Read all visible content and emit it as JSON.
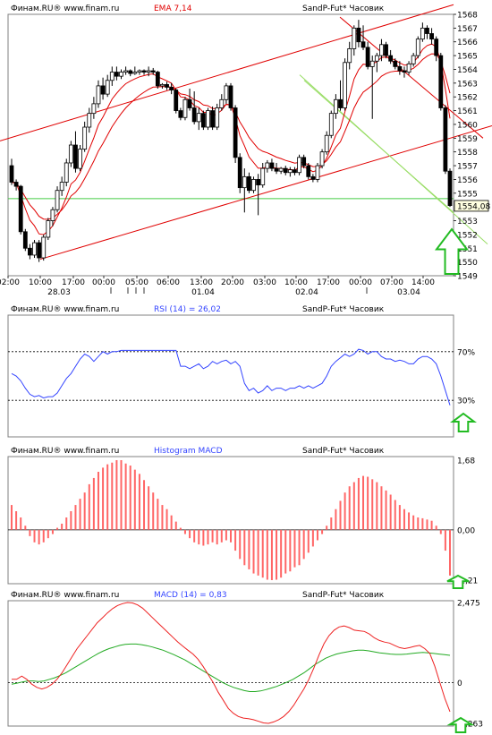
{
  "source": "Финам.RU®  www.finam.ru",
  "instrument": "SandP-Fut* Часовик",
  "colors": {
    "background": "#ffffff",
    "panel_border": "#808080",
    "ema": "#e00000",
    "channel": "#e00000",
    "fan": "#99dd66",
    "horizontal": "#44cc44",
    "rsi": "#3344ff",
    "histogram": "#ff6666",
    "macd": "#ee2222",
    "signal": "#22aa22",
    "arrow": "#22bb22",
    "price_box": "#ffffe0"
  },
  "chart_data": [
    {
      "type": "candlestick",
      "title": "EMA 7,14",
      "last_price": "1554,08",
      "ylim": [
        1549,
        1568
      ],
      "y_ticks": [
        "1568",
        "1567",
        "1566",
        "1565",
        "1564",
        "1563",
        "1562",
        "1561",
        "1560",
        "1559",
        "1558",
        "1557",
        "1556",
        "1555",
        "1554,08",
        "1553",
        "1552",
        "1551",
        "1550",
        "1549"
      ],
      "x_ticks": [
        "02:00",
        "10:00",
        "17:00",
        "00:00",
        "05:00",
        "06:00",
        "13:00",
        "20:00",
        "03:00",
        "10:00",
        "17:00",
        "00:00",
        "07:00",
        "14:00"
      ],
      "date_labels": [
        "28.03",
        "01.04",
        "02.04",
        "03.04"
      ],
      "series": [
        {
          "name": "EMA 7",
          "kind": "line"
        },
        {
          "name": "EMA 14",
          "kind": "line"
        }
      ],
      "candles": [
        [
          1557.0,
          1557.5,
          1555.6,
          1555.8
        ],
        [
          1555.8,
          1556.0,
          1555.2,
          1555.5
        ],
        [
          1555.5,
          1555.6,
          1552.0,
          1552.2
        ],
        [
          1552.2,
          1552.4,
          1550.8,
          1551.0
        ],
        [
          1551.0,
          1551.3,
          1550.2,
          1550.5
        ],
        [
          1550.5,
          1551.6,
          1550.3,
          1551.4
        ],
        [
          1551.4,
          1551.6,
          1550.0,
          1550.3
        ],
        [
          1550.3,
          1552.0,
          1550.1,
          1551.8
        ],
        [
          1551.8,
          1553.2,
          1551.6,
          1553.0
        ],
        [
          1553.0,
          1554.0,
          1552.6,
          1553.8
        ],
        [
          1553.8,
          1555.5,
          1553.6,
          1555.2
        ],
        [
          1555.2,
          1556.2,
          1554.8,
          1555.8
        ],
        [
          1555.8,
          1557.5,
          1555.5,
          1557.2
        ],
        [
          1557.2,
          1558.8,
          1556.9,
          1558.5
        ],
        [
          1558.5,
          1559.5,
          1556.5,
          1556.8
        ],
        [
          1556.8,
          1558.5,
          1556.6,
          1558.2
        ],
        [
          1558.2,
          1560.2,
          1558.0,
          1559.8
        ],
        [
          1559.8,
          1561.2,
          1559.4,
          1560.8
        ],
        [
          1560.8,
          1562.0,
          1560.4,
          1561.5
        ],
        [
          1561.5,
          1563.2,
          1561.2,
          1562.8
        ],
        [
          1562.8,
          1563.4,
          1561.8,
          1562.2
        ],
        [
          1562.2,
          1563.6,
          1562.0,
          1563.2
        ],
        [
          1563.2,
          1564.2,
          1562.8,
          1563.8
        ],
        [
          1563.8,
          1564.2,
          1563.2,
          1563.5
        ],
        [
          1563.5,
          1564.0,
          1563.3,
          1563.8
        ],
        [
          1563.8,
          1564.2,
          1563.6,
          1563.9
        ],
        [
          1563.9,
          1564.0,
          1563.5,
          1563.7
        ],
        [
          1563.7,
          1564.2,
          1563.6,
          1563.8
        ],
        [
          1563.8,
          1564.0,
          1563.6,
          1563.9
        ],
        [
          1563.9,
          1564.0,
          1563.6,
          1563.8
        ],
        [
          1563.8,
          1564.2,
          1563.5,
          1563.9
        ],
        [
          1563.9,
          1564.1,
          1563.6,
          1563.8
        ],
        [
          1563.8,
          1563.9,
          1562.6,
          1562.8
        ],
        [
          1562.8,
          1563.0,
          1562.6,
          1562.9
        ],
        [
          1562.9,
          1563.1,
          1562.5,
          1562.7
        ],
        [
          1562.7,
          1563.0,
          1562.2,
          1562.5
        ],
        [
          1562.5,
          1562.6,
          1560.8,
          1561.0
        ],
        [
          1561.0,
          1561.2,
          1560.3,
          1560.5
        ],
        [
          1560.5,
          1562.0,
          1560.3,
          1561.8
        ],
        [
          1561.8,
          1562.6,
          1561.0,
          1561.2
        ],
        [
          1561.2,
          1562.4,
          1560.0,
          1560.2
        ],
        [
          1560.2,
          1561.2,
          1559.6,
          1560.8
        ],
        [
          1560.8,
          1561.0,
          1559.6,
          1559.8
        ],
        [
          1559.8,
          1561.2,
          1559.6,
          1561.0
        ],
        [
          1561.0,
          1561.3,
          1559.6,
          1559.8
        ],
        [
          1559.8,
          1561.5,
          1559.6,
          1561.2
        ],
        [
          1561.2,
          1562.2,
          1561.0,
          1561.8
        ],
        [
          1561.8,
          1563.0,
          1561.5,
          1562.8
        ],
        [
          1562.8,
          1563.0,
          1561.0,
          1561.2
        ],
        [
          1561.2,
          1561.4,
          1557.2,
          1557.6
        ],
        [
          1557.6,
          1557.9,
          1555.0,
          1555.4
        ],
        [
          1555.4,
          1556.8,
          1553.6,
          1556.2
        ],
        [
          1556.2,
          1556.5,
          1555.0,
          1555.2
        ],
        [
          1555.2,
          1556.2,
          1555.0,
          1556.0
        ],
        [
          1556.0,
          1556.4,
          1553.4,
          1555.6
        ],
        [
          1555.6,
          1557.2,
          1555.4,
          1556.8
        ],
        [
          1556.8,
          1557.4,
          1556.5,
          1557.2
        ],
        [
          1557.2,
          1557.5,
          1556.6,
          1556.8
        ],
        [
          1556.8,
          1557.2,
          1556.4,
          1556.6
        ],
        [
          1556.6,
          1556.9,
          1556.4,
          1556.8
        ],
        [
          1556.8,
          1557.0,
          1556.3,
          1556.5
        ],
        [
          1556.5,
          1556.9,
          1556.2,
          1556.7
        ],
        [
          1556.7,
          1556.9,
          1556.3,
          1556.5
        ],
        [
          1556.5,
          1557.8,
          1556.3,
          1557.6
        ],
        [
          1557.6,
          1557.8,
          1556.8,
          1557.0
        ],
        [
          1557.0,
          1557.2,
          1556.0,
          1556.2
        ],
        [
          1556.2,
          1556.4,
          1555.8,
          1556.0
        ],
        [
          1556.0,
          1557.2,
          1555.8,
          1557.0
        ],
        [
          1557.0,
          1558.2,
          1556.8,
          1558.0
        ],
        [
          1558.0,
          1559.5,
          1557.8,
          1559.2
        ],
        [
          1559.2,
          1561.0,
          1559.0,
          1560.8
        ],
        [
          1560.8,
          1562.2,
          1560.4,
          1561.8
        ],
        [
          1561.8,
          1563.2,
          1561.0,
          1561.2
        ],
        [
          1561.2,
          1564.8,
          1561.0,
          1564.5
        ],
        [
          1564.5,
          1566.0,
          1564.0,
          1565.5
        ],
        [
          1565.5,
          1567.2,
          1565.0,
          1567.0
        ],
        [
          1567.0,
          1567.6,
          1565.6,
          1566.0
        ],
        [
          1566.0,
          1567.2,
          1565.4,
          1565.6
        ],
        [
          1565.6,
          1566.0,
          1564.0,
          1564.2
        ],
        [
          1564.2,
          1565.0,
          1560.4,
          1564.6
        ],
        [
          1564.6,
          1565.2,
          1563.8,
          1565.0
        ],
        [
          1565.0,
          1566.2,
          1564.6,
          1565.8
        ],
        [
          1565.8,
          1566.0,
          1564.8,
          1565.0
        ],
        [
          1565.0,
          1565.4,
          1564.4,
          1564.6
        ],
        [
          1564.6,
          1564.8,
          1564.0,
          1564.2
        ],
        [
          1564.2,
          1564.6,
          1563.6,
          1563.9
        ],
        [
          1563.9,
          1564.2,
          1563.4,
          1563.8
        ],
        [
          1563.8,
          1564.6,
          1563.6,
          1564.4
        ],
        [
          1564.4,
          1565.2,
          1564.2,
          1565.0
        ],
        [
          1565.0,
          1566.4,
          1564.8,
          1566.2
        ],
        [
          1566.2,
          1567.4,
          1566.0,
          1567.0
        ],
        [
          1567.0,
          1567.2,
          1566.2,
          1566.6
        ],
        [
          1566.6,
          1567.0,
          1565.8,
          1566.2
        ],
        [
          1566.2,
          1566.4,
          1564.6,
          1565.0
        ],
        [
          1565.0,
          1565.2,
          1561.0,
          1561.2
        ],
        [
          1561.2,
          1561.4,
          1556.4,
          1556.6
        ],
        [
          1556.6,
          1556.8,
          1554.0,
          1554.1
        ]
      ]
    },
    {
      "type": "line",
      "title": "RSI (14) = 26,02",
      "ylim": [
        0,
        100
      ],
      "y_ticks": [
        "70%",
        "30%"
      ],
      "series": [
        {
          "name": "RSI (14)",
          "values": [
            52,
            50,
            46,
            40,
            35,
            33,
            34,
            32,
            33,
            33,
            36,
            42,
            48,
            52,
            58,
            64,
            68,
            66,
            62,
            66,
            70,
            68,
            70,
            70,
            71,
            71,
            71,
            71,
            71,
            71,
            71,
            71,
            71,
            71,
            71,
            71,
            71,
            58,
            58,
            56,
            58,
            60,
            56,
            58,
            62,
            60,
            62,
            63,
            60,
            62,
            58,
            44,
            38,
            40,
            36,
            38,
            42,
            38,
            40,
            40,
            38,
            40,
            40,
            42,
            40,
            42,
            40,
            42,
            44,
            50,
            58,
            62,
            65,
            68,
            66,
            68,
            72,
            71,
            68,
            70,
            70,
            66,
            64,
            64,
            62,
            63,
            62,
            60,
            60,
            64,
            66,
            66,
            64,
            60,
            50,
            38,
            26
          ]
        }
      ]
    },
    {
      "type": "bar",
      "title": "Histogram MACD",
      "y_tick_labels": [
        "1,68",
        "0,00",
        "-1,21"
      ],
      "ylim": [
        -1.21,
        1.68
      ],
      "series": [
        {
          "name": "Histogram MACD",
          "values": [
            0.6,
            0.45,
            0.3,
            0.1,
            -0.15,
            -0.3,
            -0.35,
            -0.3,
            -0.2,
            -0.1,
            0.05,
            0.15,
            0.3,
            0.45,
            0.6,
            0.75,
            0.9,
            1.1,
            1.25,
            1.4,
            1.5,
            1.58,
            1.62,
            1.68,
            1.68,
            1.6,
            1.55,
            1.45,
            1.35,
            1.2,
            1.05,
            0.9,
            0.75,
            0.6,
            0.5,
            0.35,
            0.2,
            0.05,
            -0.1,
            -0.2,
            -0.3,
            -0.35,
            -0.38,
            -0.35,
            -0.3,
            -0.35,
            -0.3,
            -0.25,
            -0.3,
            -0.5,
            -0.7,
            -0.85,
            -0.95,
            -1.05,
            -1.1,
            -1.15,
            -1.2,
            -1.21,
            -1.2,
            -1.15,
            -1.05,
            -1.0,
            -0.9,
            -0.85,
            -0.7,
            -0.55,
            -0.4,
            -0.25,
            -0.1,
            0.1,
            0.3,
            0.5,
            0.7,
            0.9,
            1.05,
            1.15,
            1.25,
            1.3,
            1.28,
            1.22,
            1.15,
            1.05,
            0.95,
            0.85,
            0.72,
            0.6,
            0.5,
            0.42,
            0.35,
            0.3,
            0.28,
            0.25,
            0.22,
            0.1,
            -0.1,
            -0.5,
            -1.1
          ]
        }
      ]
    },
    {
      "type": "line",
      "title": "MACD (14) = 0,83",
      "y_tick_labels": [
        "2,475",
        "0",
        "-1,263"
      ],
      "ylim": [
        -1.263,
        2.475
      ],
      "series": [
        {
          "name": "MACD (14)",
          "values": [
            0.1,
            0.1,
            0.2,
            0.1,
            -0.05,
            -0.15,
            -0.2,
            -0.15,
            -0.05,
            0.1,
            0.3,
            0.55,
            0.8,
            1.05,
            1.25,
            1.45,
            1.65,
            1.85,
            2.0,
            2.15,
            2.28,
            2.38,
            2.44,
            2.475,
            2.46,
            2.4,
            2.3,
            2.15,
            2.0,
            1.85,
            1.7,
            1.55,
            1.4,
            1.25,
            1.12,
            1.0,
            0.88,
            0.72,
            0.5,
            0.25,
            0.0,
            -0.3,
            -0.55,
            -0.8,
            -0.95,
            -1.05,
            -1.1,
            -1.12,
            -1.15,
            -1.2,
            -1.25,
            -1.263,
            -1.22,
            -1.15,
            -1.05,
            -0.9,
            -0.7,
            -0.45,
            -0.2,
            0.1,
            0.45,
            0.85,
            1.2,
            1.45,
            1.62,
            1.72,
            1.75,
            1.7,
            1.62,
            1.6,
            1.58,
            1.5,
            1.38,
            1.3,
            1.25,
            1.22,
            1.15,
            1.08,
            1.05,
            1.08,
            1.12,
            1.15,
            1.05,
            0.9,
            0.5,
            0.0,
            -0.5,
            -0.9
          ]
        },
        {
          "name": "Signal",
          "values": [
            -0.05,
            -0.02,
            0.02,
            0.05,
            0.05,
            0.03,
            0.05,
            0.1,
            0.15,
            0.22,
            0.3,
            0.4,
            0.5,
            0.6,
            0.7,
            0.8,
            0.9,
            0.98,
            1.05,
            1.1,
            1.15,
            1.18,
            1.19,
            1.19,
            1.17,
            1.14,
            1.1,
            1.05,
            1.0,
            0.93,
            0.86,
            0.78,
            0.7,
            0.6,
            0.5,
            0.4,
            0.3,
            0.2,
            0.1,
            0.0,
            -0.08,
            -0.15,
            -0.2,
            -0.25,
            -0.28,
            -0.28,
            -0.26,
            -0.22,
            -0.17,
            -0.12,
            -0.05,
            0.02,
            0.1,
            0.2,
            0.3,
            0.42,
            0.55,
            0.65,
            0.75,
            0.82,
            0.88,
            0.92,
            0.95,
            0.98,
            1.0,
            1.0,
            0.98,
            0.95,
            0.92,
            0.9,
            0.88,
            0.87,
            0.87,
            0.88,
            0.9,
            0.92,
            0.93,
            0.92,
            0.9,
            0.88,
            0.86,
            0.84
          ]
        }
      ]
    }
  ]
}
